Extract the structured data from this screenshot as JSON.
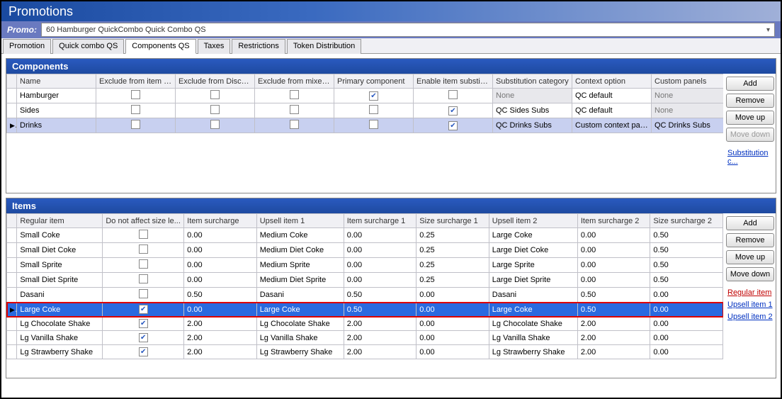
{
  "title": "Promotions",
  "promo": {
    "label": "Promo:",
    "value": "60 Hamburger QuickCombo Quick Combo QS"
  },
  "tabs": [
    {
      "label": "Promotion",
      "active": false
    },
    {
      "label": "Quick combo QS",
      "active": false
    },
    {
      "label": "Components QS",
      "active": true
    },
    {
      "label": "Taxes",
      "active": false
    },
    {
      "label": "Restrictions",
      "active": false
    },
    {
      "label": "Token Distribution",
      "active": false
    }
  ],
  "components": {
    "header": "Components",
    "cols": [
      "Name",
      "Exclude from item co...",
      "Exclude from Discount",
      "Exclude from mixed l...",
      "Primary component",
      "Enable item substitu...",
      "Substitution category",
      "Context option",
      "Custom panels"
    ],
    "rows": [
      {
        "sel": false,
        "name": "Hamburger",
        "c1": false,
        "c2": false,
        "c3": false,
        "c4": true,
        "c5": false,
        "sub": "None",
        "ctx": "QC default",
        "panels": "None",
        "disabled": [
          "sub",
          "panels"
        ]
      },
      {
        "sel": false,
        "name": "Sides",
        "c1": false,
        "c2": false,
        "c3": false,
        "c4": false,
        "c5": true,
        "sub": "QC Sides Subs",
        "ctx": "QC default",
        "panels": "None",
        "disabled": [
          "panels"
        ]
      },
      {
        "sel": true,
        "name": "Drinks",
        "c1": false,
        "c2": false,
        "c3": false,
        "c4": false,
        "c5": true,
        "sub": "QC Drinks Subs",
        "ctx": "Custom context panel",
        "panels": "QC Drinks Subs",
        "disabled": []
      }
    ],
    "buttons": {
      "add": "Add",
      "remove": "Remove",
      "moveup": "Move up",
      "movedown": "Move down"
    },
    "link": "Substitution c..."
  },
  "items": {
    "header": "Items",
    "cols": [
      "Regular item",
      "Do not affect size le...",
      "Item surcharge",
      "Upsell item 1",
      "Item surcharge 1",
      "Size surcharge 1",
      "Upsell item 2",
      "Item surcharge 2",
      "Size surcharge 2"
    ],
    "rows": [
      {
        "sel": false,
        "name": "Small Coke",
        "c1": false,
        "s": "0.00",
        "u1": "Medium Coke",
        "is1": "0.00",
        "ss1": "0.25",
        "u2": "Large Coke",
        "is2": "0.00",
        "ss2": "0.50",
        "hl": false
      },
      {
        "sel": false,
        "name": "Small Diet Coke",
        "c1": false,
        "s": "0.00",
        "u1": "Medium Diet Coke",
        "is1": "0.00",
        "ss1": "0.25",
        "u2": "Large Diet Coke",
        "is2": "0.00",
        "ss2": "0.50",
        "hl": false
      },
      {
        "sel": false,
        "name": "Small Sprite",
        "c1": false,
        "s": "0.00",
        "u1": "Medium Sprite",
        "is1": "0.00",
        "ss1": "0.25",
        "u2": "Large Sprite",
        "is2": "0.00",
        "ss2": "0.50",
        "hl": false
      },
      {
        "sel": false,
        "name": "Small Diet Sprite",
        "c1": false,
        "s": "0.00",
        "u1": "Medium Diet Sprite",
        "is1": "0.00",
        "ss1": "0.25",
        "u2": "Large Diet Sprite",
        "is2": "0.00",
        "ss2": "0.50",
        "hl": false
      },
      {
        "sel": false,
        "name": "Dasani",
        "c1": false,
        "s": "0.50",
        "u1": "Dasani",
        "is1": "0.50",
        "ss1": "0.00",
        "u2": "Dasani",
        "is2": "0.50",
        "ss2": "0.00",
        "hl": false
      },
      {
        "sel": true,
        "name": "Large Coke",
        "c1": true,
        "s": "0.00",
        "u1": "Large Coke",
        "is1": "0.50",
        "ss1": "0.00",
        "u2": "Large Coke",
        "is2": "0.50",
        "ss2": "0.00",
        "hl": true
      },
      {
        "sel": false,
        "name": "Lg Chocolate Shake",
        "c1": true,
        "s": "2.00",
        "u1": "Lg Chocolate Shake",
        "is1": "2.00",
        "ss1": "0.00",
        "u2": "Lg Chocolate Shake",
        "is2": "2.00",
        "ss2": "0.00",
        "hl": false
      },
      {
        "sel": false,
        "name": "Lg Vanilla Shake",
        "c1": true,
        "s": "2.00",
        "u1": "Lg Vanilla Shake",
        "is1": "2.00",
        "ss1": "0.00",
        "u2": "Lg Vanilla Shake",
        "is2": "2.00",
        "ss2": "0.00",
        "hl": false
      },
      {
        "sel": false,
        "name": "Lg Strawberry Shake",
        "c1": true,
        "s": "2.00",
        "u1": "Lg Strawberry Shake",
        "is1": "2.00",
        "ss1": "0.00",
        "u2": "Lg Strawberry Shake",
        "is2": "2.00",
        "ss2": "0.00",
        "hl": false
      }
    ],
    "buttons": {
      "add": "Add",
      "remove": "Remove",
      "moveup": "Move up",
      "movedown": "Move down"
    },
    "links": {
      "reg": "Regular item",
      "u1": "Upsell item 1",
      "u2": "Upsell item 2"
    }
  }
}
